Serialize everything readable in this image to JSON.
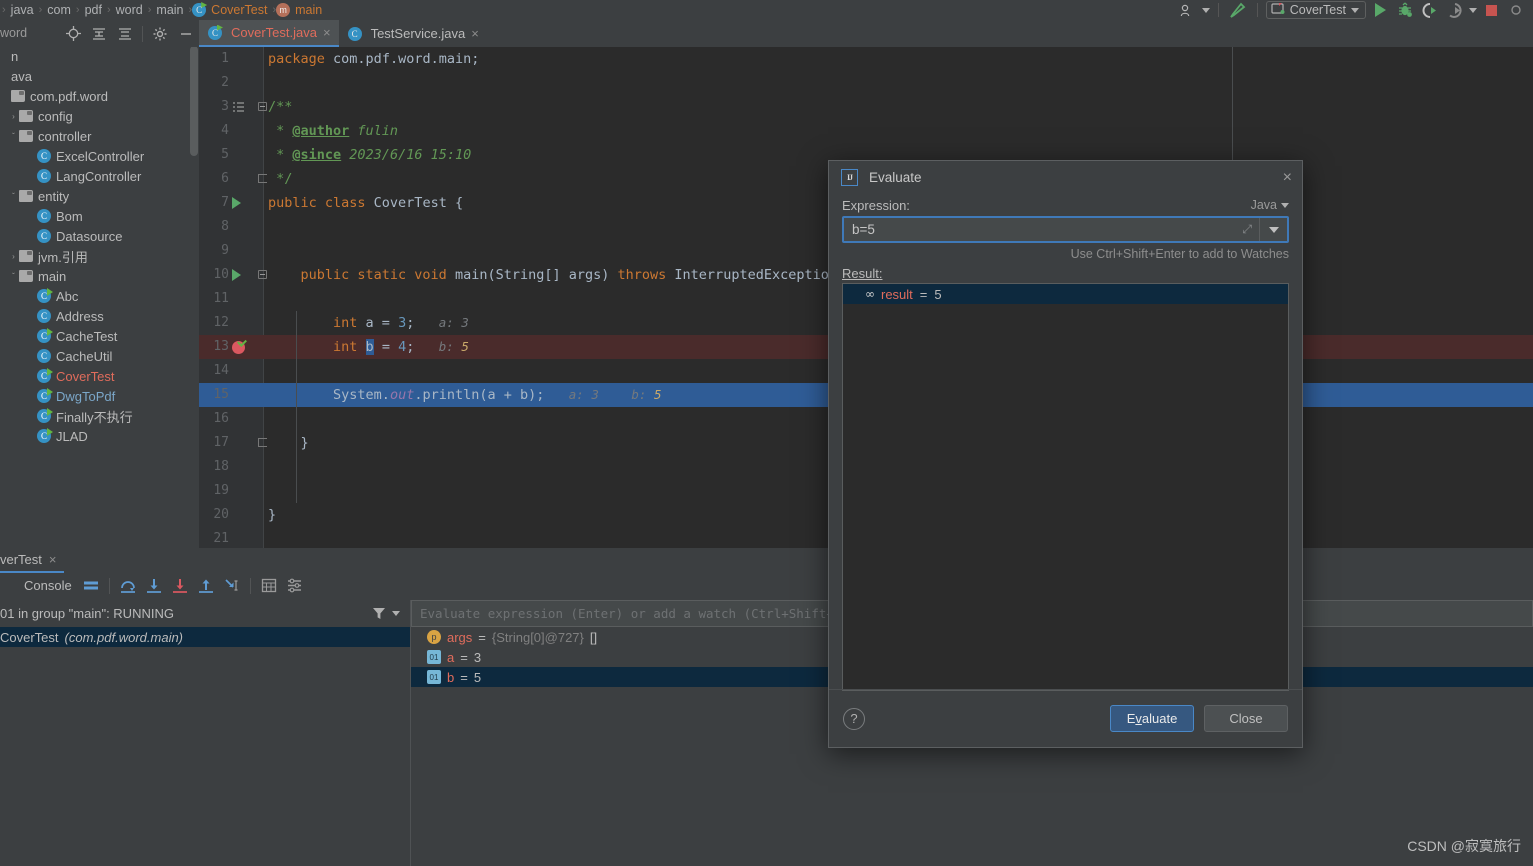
{
  "breadcrumb": {
    "items": [
      "java",
      "com",
      "pdf",
      "word",
      "main"
    ],
    "class_name": "CoverTest",
    "method_name": "main",
    "sep": "›"
  },
  "toolbar": {
    "profile_icon": "user-profile-icon",
    "hammer_icon": "build-icon",
    "run_config": "CoverTest",
    "run_icon": "run-icon",
    "debug_icon": "debug-icon",
    "run_coverage_icon": "run-with-coverage-icon",
    "profiler_icon": "profiler-icon",
    "stop_icon": "stop-icon",
    "caret": "▾"
  },
  "project_panel": {
    "header": "word",
    "tree": [
      {
        "indent": 0,
        "arrow": "",
        "icon": "none",
        "label": "n",
        "color": "normal"
      },
      {
        "indent": 0,
        "arrow": "",
        "icon": "none",
        "label": "ava",
        "color": "normal"
      },
      {
        "indent": 0,
        "arrow": "",
        "icon": "folder",
        "label": "com.pdf.word",
        "color": "normal"
      },
      {
        "indent": 1,
        "arrow": "›",
        "icon": "folder",
        "label": "config",
        "color": "normal"
      },
      {
        "indent": 1,
        "arrow": "⌄",
        "icon": "folder",
        "label": "controller",
        "color": "normal"
      },
      {
        "indent": 2,
        "arrow": "",
        "icon": "class",
        "label": "ExcelController",
        "color": "normal"
      },
      {
        "indent": 2,
        "arrow": "",
        "icon": "class",
        "label": "LangController",
        "color": "normal"
      },
      {
        "indent": 1,
        "arrow": "⌄",
        "icon": "folder",
        "label": "entity",
        "color": "normal"
      },
      {
        "indent": 2,
        "arrow": "",
        "icon": "class",
        "label": "Bom",
        "color": "normal"
      },
      {
        "indent": 2,
        "arrow": "",
        "icon": "class",
        "label": "Datasource",
        "color": "normal"
      },
      {
        "indent": 1,
        "arrow": "›",
        "icon": "folder",
        "label": "jvm.引用",
        "color": "normal"
      },
      {
        "indent": 1,
        "arrow": "⌄",
        "icon": "folder",
        "label": "main",
        "color": "normal"
      },
      {
        "indent": 2,
        "arrow": "",
        "icon": "class-run",
        "label": "Abc",
        "color": "normal"
      },
      {
        "indent": 2,
        "arrow": "",
        "icon": "class",
        "label": "Address",
        "color": "normal"
      },
      {
        "indent": 2,
        "arrow": "",
        "icon": "class-run",
        "label": "CacheTest",
        "color": "normal"
      },
      {
        "indent": 2,
        "arrow": "",
        "icon": "class",
        "label": "CacheUtil",
        "color": "normal"
      },
      {
        "indent": 2,
        "arrow": "",
        "icon": "class-run",
        "label": "CoverTest",
        "color": "red"
      },
      {
        "indent": 2,
        "arrow": "",
        "icon": "class-run",
        "label": "DwgToPdf",
        "color": "blue"
      },
      {
        "indent": 2,
        "arrow": "",
        "icon": "class-run",
        "label": "Finally不执行",
        "color": "normal"
      },
      {
        "indent": 2,
        "arrow": "",
        "icon": "class-run",
        "label": "JLAD",
        "color": "normal"
      }
    ]
  },
  "editor_tabs": {
    "icons": [
      "locate-icon",
      "expand-all-icon",
      "collapse-all-icon",
      "settings-gear-icon",
      "hide-icon"
    ],
    "tabs": [
      {
        "label": "CoverTest.java",
        "active": true,
        "color": "red",
        "icon": "java-class-run-icon",
        "close": "×"
      },
      {
        "label": "TestService.java",
        "active": false,
        "color": "normal",
        "icon": "java-class-icon",
        "close": "×"
      }
    ]
  },
  "editor": {
    "lines": [
      {
        "n": "1",
        "gutter": "",
        "fold": "",
        "hl": "",
        "html": "<span class='kw'>package</span> <span class='plain'>com.pdf.word.main;</span>"
      },
      {
        "n": "2",
        "gutter": "",
        "fold": "",
        "hl": "",
        "html": ""
      },
      {
        "n": "3",
        "gutter": "doc",
        "fold": "open",
        "hl": "",
        "html": "<span class='cm'>/**</span>"
      },
      {
        "n": "4",
        "gutter": "",
        "fold": "",
        "hl": "",
        "html": "<span class='cm'> * </span><span class='tag'>@author</span><span class='cm-i'> fulin</span>"
      },
      {
        "n": "5",
        "gutter": "",
        "fold": "",
        "hl": "",
        "html": "<span class='cm'> * </span><span class='tag'>@since</span><span class='cm-i'> 2023/6/16 15:10</span>"
      },
      {
        "n": "6",
        "gutter": "",
        "fold": "end",
        "hl": "",
        "html": "<span class='cm'> */</span>"
      },
      {
        "n": "7",
        "gutter": "run",
        "fold": "",
        "hl": "",
        "html": "<span class='kw'>public class </span><span class='cls2'>CoverTest </span><span class='plain'>{</span>"
      },
      {
        "n": "8",
        "gutter": "",
        "fold": "",
        "hl": "",
        "html": ""
      },
      {
        "n": "9",
        "gutter": "",
        "fold": "",
        "hl": "",
        "html": ""
      },
      {
        "n": "10",
        "gutter": "run",
        "fold": "open",
        "hl": "",
        "html": "    <span class='kw'>public static void </span><span class='plain'>main(String[] args) </span><span class='kw'>throws </span><span class='plain'>InterruptedException {</span>"
      },
      {
        "n": "11",
        "gutter": "",
        "fold": "",
        "hl": "",
        "html": ""
      },
      {
        "n": "12",
        "gutter": "",
        "fold": "",
        "hl": "",
        "html": "        <span class='kw'>int </span><span class='plain'>a = </span><span class='num2'>3</span><span class='plain'>;</span>   <span class='hint'>a: 3</span>"
      },
      {
        "n": "13",
        "gutter": "bp",
        "fold": "",
        "hl": "hl-red",
        "html": "        <span class='kw'>int </span><span class='caretsel'>b</span><span class='plain'> = </span><span class='num2'>4</span><span class='plain'>;</span>   <span class='hint'>b: </span><span class='hintv'>5</span>"
      },
      {
        "n": "14",
        "gutter": "",
        "fold": "",
        "hl": "",
        "html": ""
      },
      {
        "n": "15",
        "gutter": "",
        "fold": "",
        "hl": "hl-blue",
        "html": "        <span class='plain'>System.</span><span class='fld'>out</span><span class='plain'>.println(a + b)</span><span class='plain'>;</span>   <span class='hint'>a: 3</span>    <span class='hint'>b: </span><span class='hintv'>5</span>"
      },
      {
        "n": "16",
        "gutter": "",
        "fold": "",
        "hl": "",
        "html": ""
      },
      {
        "n": "17",
        "gutter": "",
        "fold": "end",
        "hl": "",
        "html": "    <span class='plain'>}</span>"
      },
      {
        "n": "18",
        "gutter": "",
        "fold": "",
        "hl": "",
        "html": ""
      },
      {
        "n": "19",
        "gutter": "",
        "fold": "",
        "hl": "",
        "html": ""
      },
      {
        "n": "20",
        "gutter": "",
        "fold": "",
        "hl": "",
        "html": "<span class='plain'>}</span>"
      },
      {
        "n": "21",
        "gutter": "",
        "fold": "",
        "hl": "",
        "html": ""
      }
    ]
  },
  "debug_panel": {
    "tab_label": "verTest",
    "tab_close": "×",
    "console_label": "Console",
    "toolbar_icons": [
      "frames-icon",
      "step-over-icon",
      "step-into-icon",
      "force-step-into-icon",
      "step-out-icon",
      "run-to-cursor-icon",
      "evaluate-icon",
      "settings-icon"
    ],
    "thread_status": "01 in group \"main\": RUNNING",
    "filter_icon": "filter-icon",
    "filter_caret": "▾",
    "frame": {
      "name": "CoverTest",
      "location": "(com.pdf.word.main)"
    },
    "watch_placeholder": "Evaluate expression (Enter) or add a watch (Ctrl+Shift+Ente",
    "variables": [
      {
        "icon": "p",
        "icon_label": "p",
        "name": "args",
        "eq": "=",
        "ref": "{String[0]@727}",
        "value": "[]",
        "selected": false
      },
      {
        "icon": "prim",
        "icon_label": "01",
        "name": "a",
        "eq": "=",
        "ref": "",
        "value": "3",
        "selected": false
      },
      {
        "icon": "prim",
        "icon_label": "01",
        "name": "b",
        "eq": "=",
        "ref": "",
        "value": "5",
        "selected": true
      }
    ]
  },
  "evaluate_dialog": {
    "title": "Evaluate",
    "logo": "intellij-idea-icon",
    "close": "×",
    "expression_label": "Expression:",
    "language": "Java",
    "language_caret": "▾",
    "expression_value": "b=5",
    "expand_icon": "⤢",
    "dropdown_caret": "▼",
    "watch_hint": "Use Ctrl+Shift+Enter to add to Watches",
    "result_label": "Result:",
    "result": {
      "icon": "∞",
      "name": "result",
      "eq": "=",
      "value": "5"
    },
    "help_label": "?",
    "evaluate_button": "Evaluate",
    "evaluate_button_mnemonic": "v",
    "close_button": "Close"
  },
  "watermark": "CSDN @寂寞旅行",
  "colors": {
    "accent_blue": "#4a88c7",
    "selection_blue": "#2f5c96",
    "breakpoint_red": "#db5860",
    "run_green": "#59a869",
    "panel_bg": "#3c3f41",
    "editor_bg": "#2b2b2b"
  }
}
